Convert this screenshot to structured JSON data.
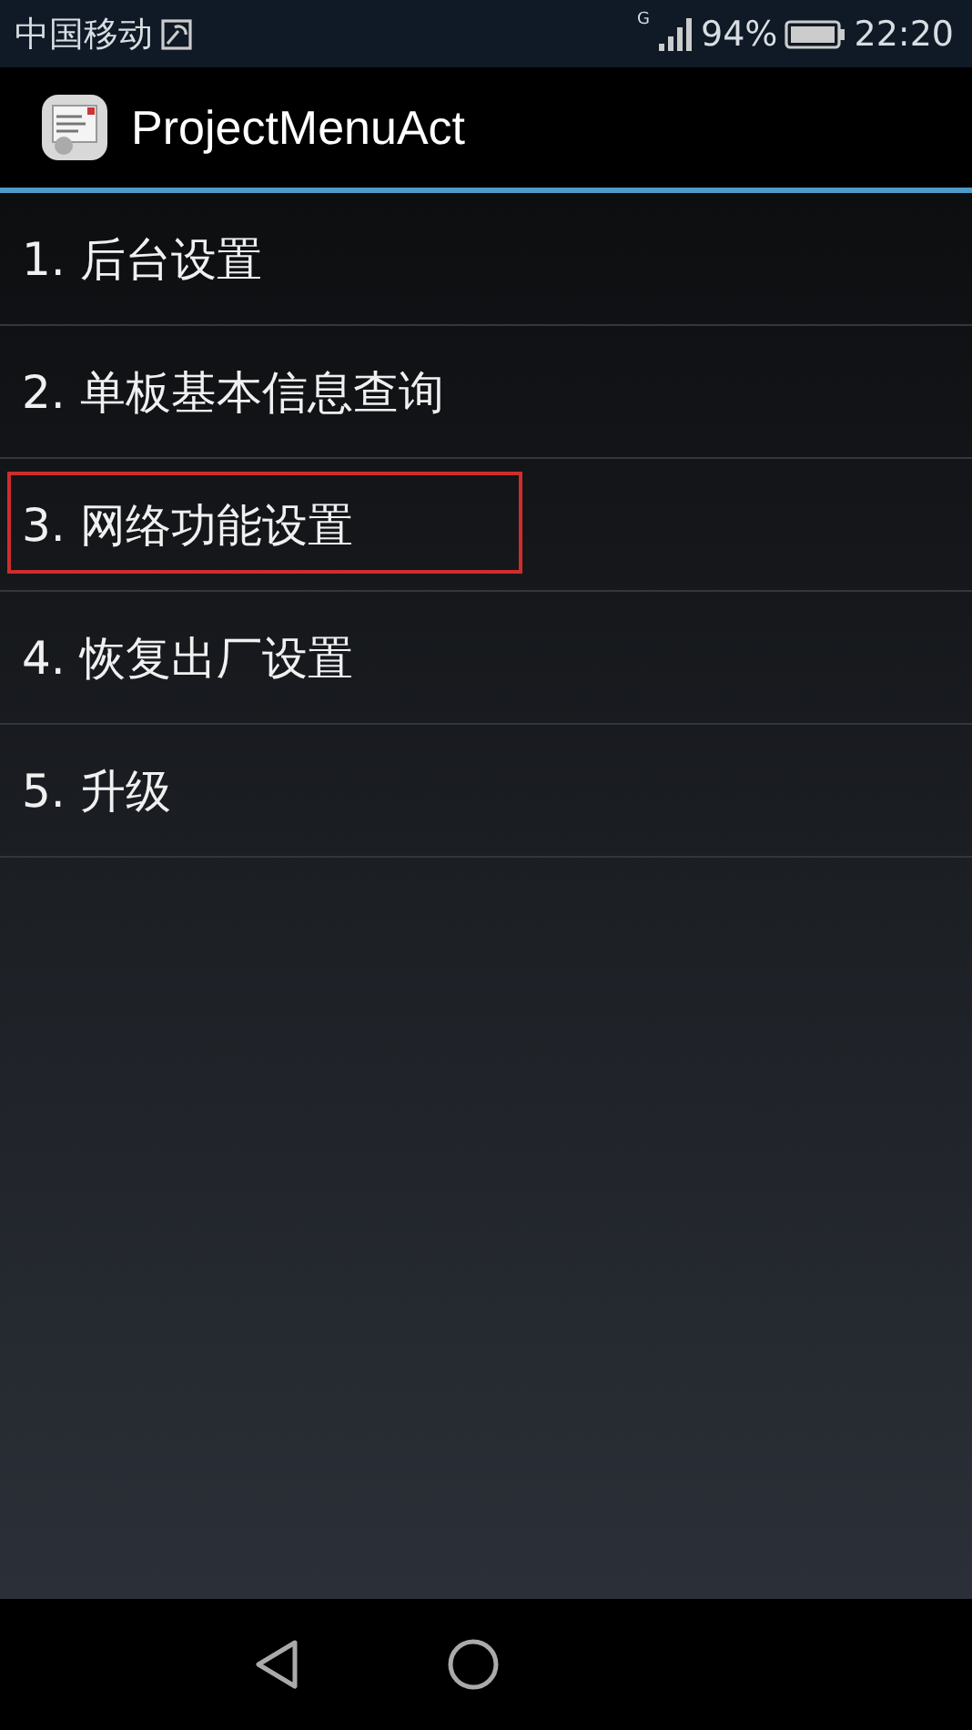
{
  "status_bar": {
    "carrier": "中国移动",
    "network": "G",
    "battery": "94%",
    "time": "22:20"
  },
  "action_bar": {
    "title": "ProjectMenuAct"
  },
  "menu": {
    "items": [
      {
        "label": "1. 后台设置",
        "highlighted": false
      },
      {
        "label": "2. 单板基本信息查询",
        "highlighted": false
      },
      {
        "label": "3. 网络功能设置",
        "highlighted": true
      },
      {
        "label": "4. 恢复出厂设置",
        "highlighted": false
      },
      {
        "label": "5. 升级",
        "highlighted": false
      }
    ]
  }
}
